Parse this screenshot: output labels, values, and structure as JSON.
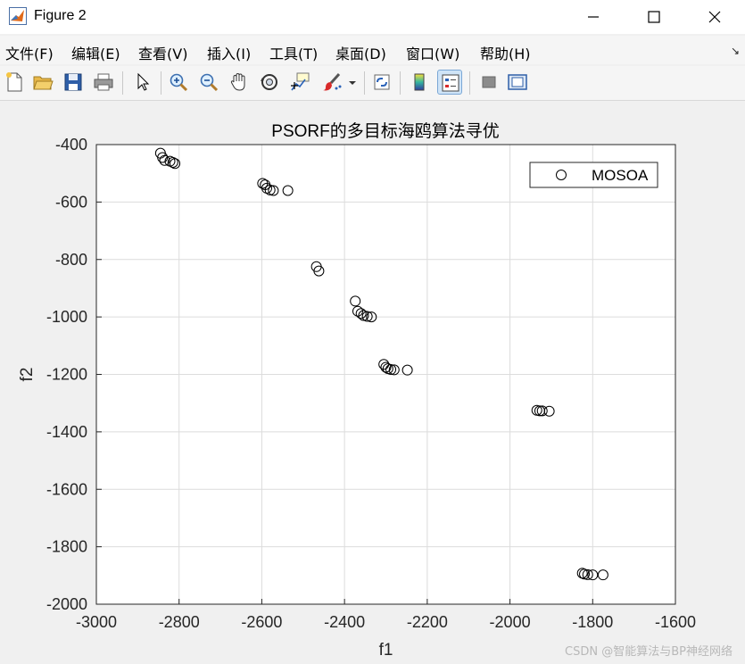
{
  "window": {
    "title": "Figure 2",
    "controls": [
      "minimize",
      "maximize",
      "close"
    ]
  },
  "menu": {
    "items": [
      "文件(F)",
      "编辑(E)",
      "查看(V)",
      "插入(I)",
      "工具(T)",
      "桌面(D)",
      "窗口(W)",
      "帮助(H)"
    ],
    "corner_glyph": "↘"
  },
  "toolbar": {
    "icons": [
      "new-figure-icon",
      "open-file-icon",
      "save-icon",
      "print-icon",
      "select-pointer-icon",
      "zoom-in-icon",
      "zoom-out-icon",
      "pan-hand-icon",
      "rotate-3d-icon",
      "data-cursor-icon",
      "brush-icon",
      "link-plot-icon",
      "colorbar-icon",
      "legend-icon",
      "hide-plot-tools-icon",
      "show-plot-tools-icon"
    ],
    "active": "legend-icon"
  },
  "chart_data": {
    "type": "scatter",
    "title": "PSORF的多目标海鸥算法寻优",
    "xlabel": "f1",
    "ylabel": "f2",
    "xlim": [
      -3000,
      -1600
    ],
    "ylim": [
      -2000,
      -400
    ],
    "xticks": [
      -3000,
      -2800,
      -2600,
      -2400,
      -2200,
      -2000,
      -1800,
      -1600
    ],
    "yticks": [
      -400,
      -600,
      -800,
      -1000,
      -1200,
      -1400,
      -1600,
      -1800,
      -2000
    ],
    "grid": true,
    "legend": {
      "position": "top-right",
      "entries": [
        "MOSOA"
      ]
    },
    "marker": "open-circle",
    "marker_color": "#000000",
    "series": [
      {
        "name": "MOSOA",
        "points": [
          [
            -2845,
            -430
          ],
          [
            -2840,
            -445
          ],
          [
            -2835,
            -455
          ],
          [
            -2822,
            -458
          ],
          [
            -2815,
            -462
          ],
          [
            -2810,
            -466
          ],
          [
            -2598,
            -535
          ],
          [
            -2592,
            -540
          ],
          [
            -2588,
            -552
          ],
          [
            -2580,
            -558
          ],
          [
            -2572,
            -560
          ],
          [
            -2537,
            -560
          ],
          [
            -2468,
            -825
          ],
          [
            -2462,
            -840
          ],
          [
            -2374,
            -945
          ],
          [
            -2368,
            -980
          ],
          [
            -2360,
            -988
          ],
          [
            -2354,
            -995
          ],
          [
            -2345,
            -998
          ],
          [
            -2335,
            -1000
          ],
          [
            -2305,
            -1165
          ],
          [
            -2300,
            -1175
          ],
          [
            -2295,
            -1180
          ],
          [
            -2288,
            -1183
          ],
          [
            -2280,
            -1184
          ],
          [
            -2248,
            -1185
          ],
          [
            -1935,
            -1325
          ],
          [
            -1928,
            -1327
          ],
          [
            -1922,
            -1327
          ],
          [
            -1905,
            -1328
          ],
          [
            -1825,
            -1892
          ],
          [
            -1820,
            -1895
          ],
          [
            -1812,
            -1897
          ],
          [
            -1800,
            -1898
          ],
          [
            -1775,
            -1898
          ]
        ]
      }
    ]
  },
  "watermark": "CSDN @智能算法与BP神经网络"
}
